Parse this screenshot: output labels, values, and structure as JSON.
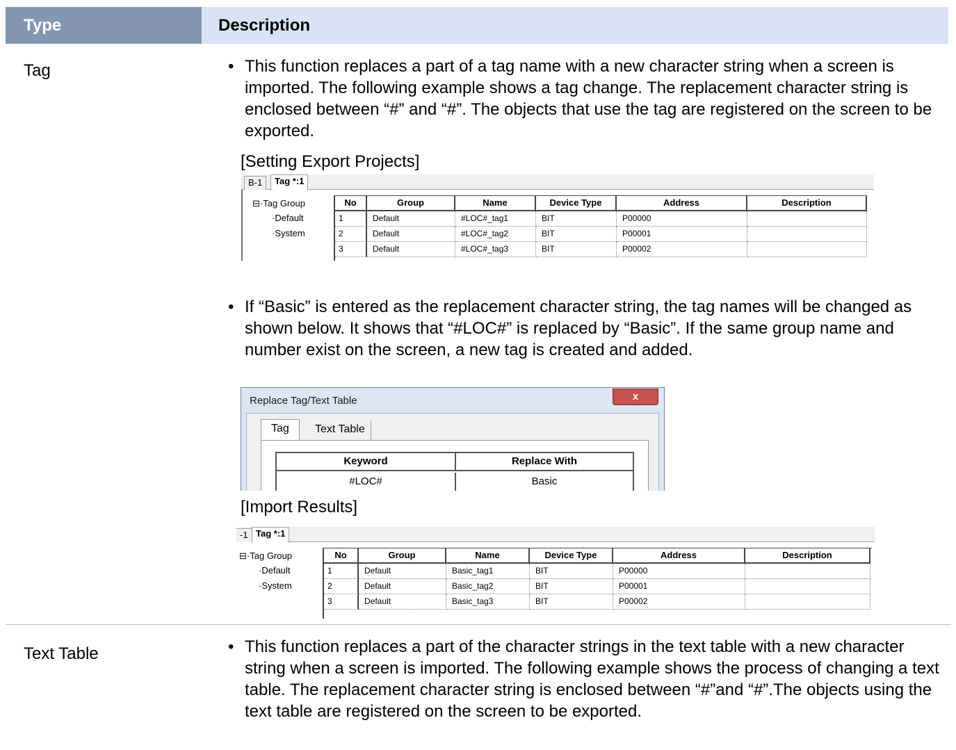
{
  "header": {
    "type": "Type",
    "description": "Description"
  },
  "rows": {
    "tag": {
      "type": "Tag",
      "bullet1": "This function replaces a part of a tag name with a new character string when a screen is imported. The following example shows a tag change. The replacement character string is enclosed between “#” and “#”. The objects that use the tag are registered on the screen to be exported.",
      "caption1": "[Setting Export Projects]",
      "bullet2": "If “Basic” is entered as the replacement character string, the tag names will be changed as shown below. It shows that “#LOC#” is replaced by “Basic”. If the same group name and number exist on the screen, a new tag is created and added.",
      "caption2": "[Import Results]"
    },
    "text_table": {
      "type": "Text Table",
      "bullet1": "This function replaces a part of the character strings in the text table with a new character string when a screen is imported. The following example shows the process of changing a text table. The replacement character string is enclosed between “#”and “#”.The objects using the text table are registered on the screen to be exported."
    }
  },
  "export_editor": {
    "tabs": [
      "B-1",
      "Tag *:1"
    ],
    "tree": [
      "Tag Group",
      "Default",
      "System"
    ],
    "columns": [
      "No",
      "Group",
      "Name",
      "Device Type",
      "Address",
      "Description"
    ],
    "rows": [
      [
        "1",
        "Default",
        "#LOC#_tag1",
        "BIT",
        "P00000",
        ""
      ],
      [
        "2",
        "Default",
        "#LOC#_tag2",
        "BIT",
        "P00001",
        ""
      ],
      [
        "3",
        "Default",
        "#LOC#_tag3",
        "BIT",
        "P00002",
        ""
      ]
    ]
  },
  "replace_dialog": {
    "title": "Replace Tag/Text Table",
    "close": "x",
    "tabs": [
      "Tag",
      "Text Table"
    ],
    "columns": [
      "Keyword",
      "Replace With"
    ],
    "row": [
      "#LOC#",
      "Basic"
    ]
  },
  "import_editor": {
    "tabs": [
      "-1",
      "Tag *:1"
    ],
    "tree": [
      "Tag Group",
      "Default",
      "System"
    ],
    "columns": [
      "No",
      "Group",
      "Name",
      "Device Type",
      "Address",
      "Description"
    ],
    "rows": [
      [
        "1",
        "Default",
        "Basic_tag1",
        "BIT",
        "P00000",
        ""
      ],
      [
        "2",
        "Default",
        "Basic_tag2",
        "BIT",
        "P00001",
        ""
      ],
      [
        "3",
        "Default",
        "Basic_tag3",
        "BIT",
        "P00002",
        ""
      ]
    ]
  }
}
